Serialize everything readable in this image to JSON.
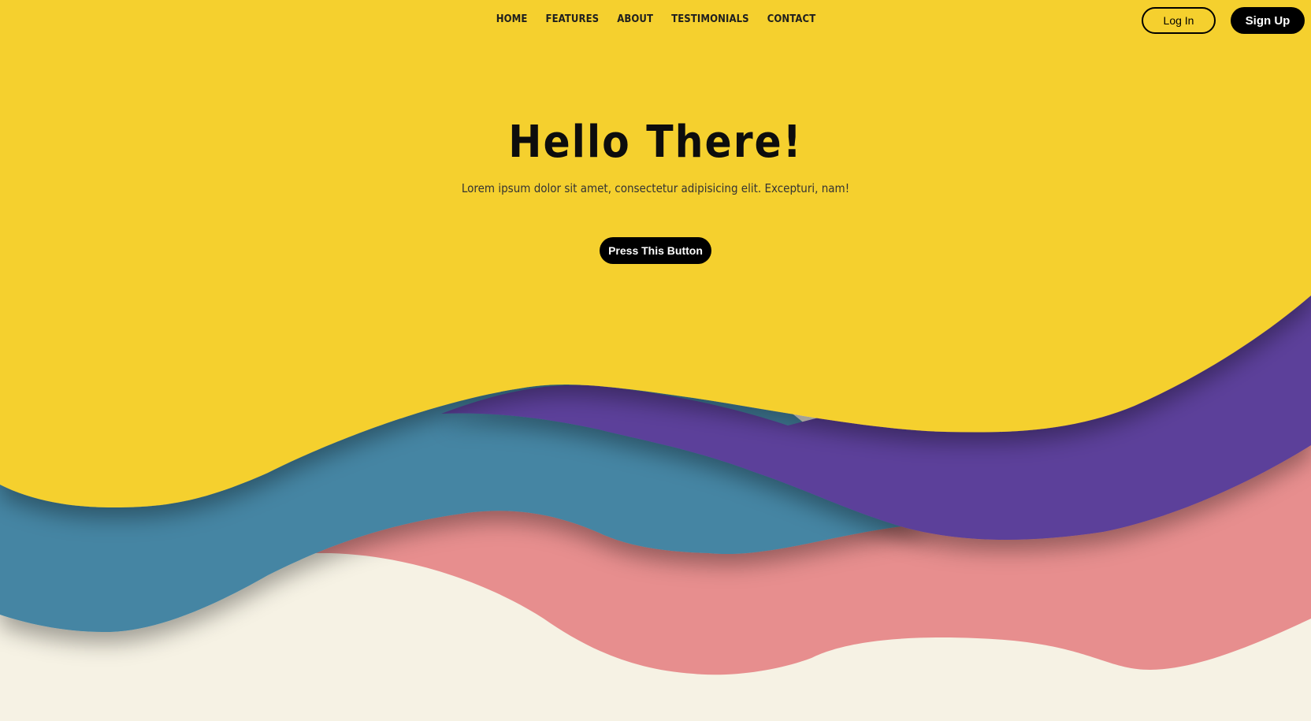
{
  "nav": {
    "items": [
      {
        "label": "HOME"
      },
      {
        "label": "FEATURES"
      },
      {
        "label": "ABOUT"
      },
      {
        "label": "TESTIMONIALS"
      },
      {
        "label": "CONTACT"
      }
    ]
  },
  "auth": {
    "login_label": "Log In",
    "signup_label": "Sign Up"
  },
  "hero": {
    "title": "Hello There!",
    "subtitle": "Lorem ipsum dolor sit amet, consectetur adipisicing elit. Excepturi, nam!",
    "button_label": "Press This Button"
  },
  "colors": {
    "yellow": "#f5d02e",
    "purple": "#5b409a",
    "blue": "#4585a3",
    "pink": "#e78e8e",
    "cream": "#f6f2e4",
    "black": "#000000"
  }
}
